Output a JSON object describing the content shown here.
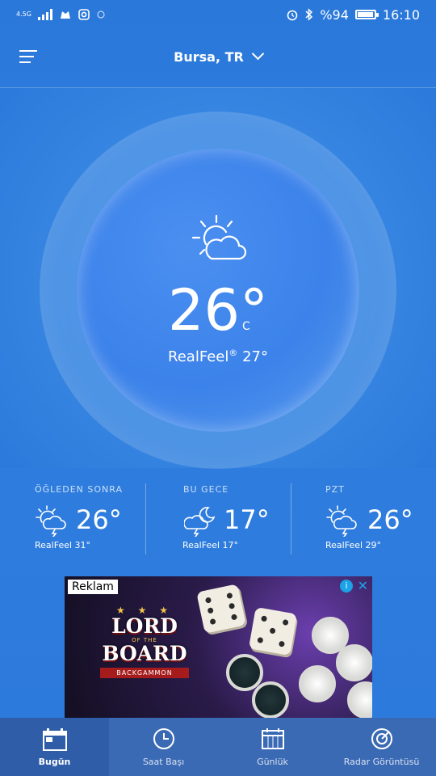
{
  "status": {
    "network": "4.5G",
    "battery": "%94",
    "battery_level": 0.94,
    "time": "16:10"
  },
  "header": {
    "location": "Bursa, TR"
  },
  "current": {
    "temp": "26°",
    "unit": "C",
    "realfeel_label": "RealFeel",
    "realfeel_mark": "®",
    "realfeel_value": "27°",
    "icon": "partly-sunny-icon"
  },
  "forecast": [
    {
      "label": "ÖĞLEDEN SONRA",
      "temp": "26°",
      "realfeel": "RealFeel 31°",
      "icon": "sun-cloud-storm-icon"
    },
    {
      "label": "BU GECE",
      "temp": "17°",
      "realfeel": "RealFeel 17°",
      "icon": "moon-cloud-storm-icon"
    },
    {
      "label": "PZT",
      "temp": "26°",
      "realfeel": "RealFeel 29°",
      "icon": "sun-cloud-storm-icon"
    }
  ],
  "ad": {
    "label": "Reklam",
    "info": "i",
    "close": "✕",
    "logo_top": "LORD",
    "logo_mid": "OF THE",
    "logo_bottom": "BOARD",
    "ribbon": "BACKGAMMON"
  },
  "nav": [
    {
      "label": "Bugün",
      "icon": "calendar-today-icon",
      "active": true
    },
    {
      "label": "Saat Başı",
      "icon": "clock-icon",
      "active": false
    },
    {
      "label": "Günlük",
      "icon": "calendar-icon",
      "active": false
    },
    {
      "label": "Radar Görüntüsü",
      "icon": "radar-icon",
      "active": false
    }
  ],
  "colors": {
    "background": "#2f7fe0",
    "nav_bg": "#3b6ab5",
    "nav_active": "#2f5da8",
    "ad_accent": "#1aa3e8"
  }
}
